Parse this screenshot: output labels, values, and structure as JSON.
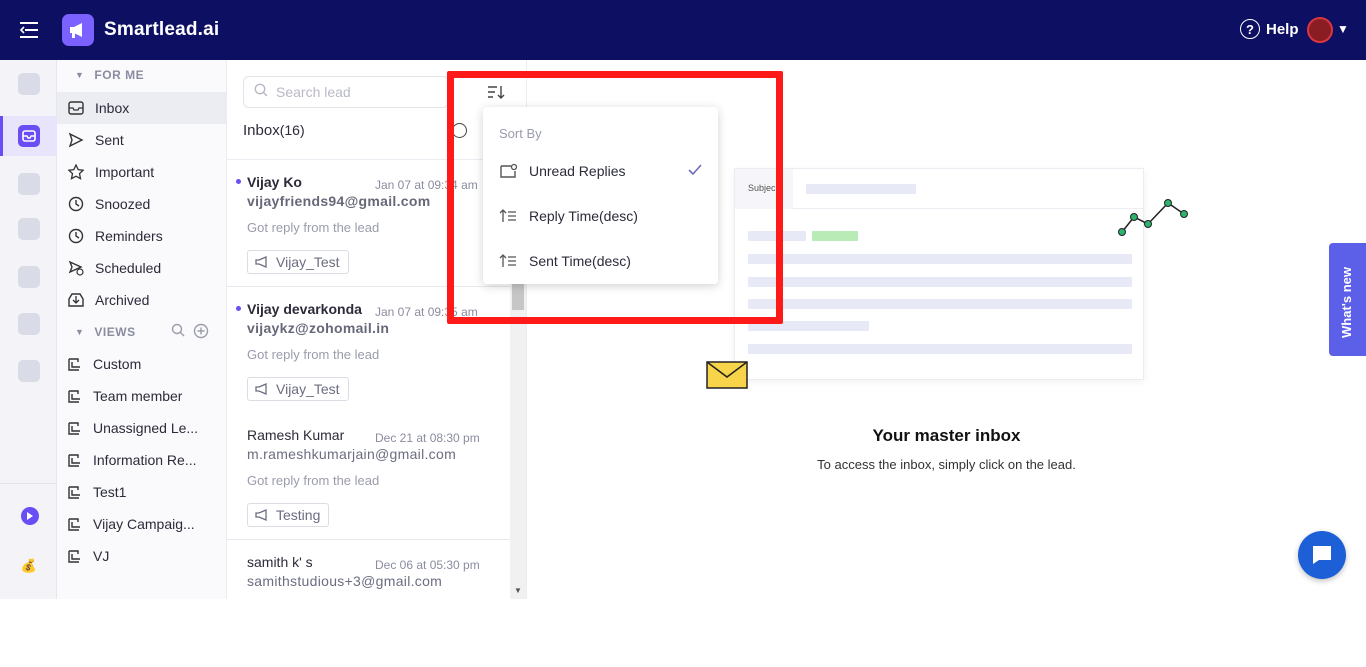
{
  "brand": {
    "name": "Smartlead.ai"
  },
  "topbar": {
    "help_label": "Help"
  },
  "nav": {
    "for_me_label": "FOR ME",
    "views_label": "VIEWS",
    "items": [
      {
        "label": "Inbox",
        "icon": "inbox-icon"
      },
      {
        "label": "Sent",
        "icon": "send-icon"
      },
      {
        "label": "Important",
        "icon": "star-icon"
      },
      {
        "label": "Snoozed",
        "icon": "clock-icon"
      },
      {
        "label": "Reminders",
        "icon": "clock-icon"
      },
      {
        "label": "Scheduled",
        "icon": "send-clock-icon"
      },
      {
        "label": "Archived",
        "icon": "archive-icon"
      }
    ],
    "views": [
      {
        "label": "Custom"
      },
      {
        "label": "Team member"
      },
      {
        "label": "Unassigned Le..."
      },
      {
        "label": "Information Re..."
      },
      {
        "label": "Test1"
      },
      {
        "label": "Vijay Campaig..."
      },
      {
        "label": "VJ"
      }
    ]
  },
  "list": {
    "search_placeholder": "Search lead",
    "title": "Inbox",
    "count": "(16)",
    "leads": [
      {
        "name": "Vijay Ko",
        "date": "Jan 07 at 09:34 am",
        "email": "vijayfriends94@gmail.com",
        "preview": "Got reply from the lead",
        "tag": "Vijay_Test",
        "unread": true
      },
      {
        "name": "Vijay devarkonda",
        "date": "Jan 07 at 09:35 am",
        "email": "vijaykz@zohomail.in",
        "preview": "Got reply from the lead",
        "tag": "Vijay_Test",
        "unread": true
      },
      {
        "name": "Ramesh Kumar",
        "date": "Dec 21 at 08:30 pm",
        "email": "m.rameshkumarjain@gmail.com",
        "preview": "Got reply from the lead",
        "tag": "Testing",
        "unread": false
      },
      {
        "name": "samith k' s",
        "date": "Dec 06 at 05:30 pm",
        "email": "samithstudious+3@gmail.com",
        "preview": "",
        "tag": "",
        "unread": false
      }
    ]
  },
  "sort_menu": {
    "header": "Sort By",
    "options": [
      {
        "label": "Unread Replies",
        "selected": true
      },
      {
        "label": "Reply Time(desc)",
        "selected": false
      },
      {
        "label": "Sent Time(desc)",
        "selected": false
      }
    ]
  },
  "main": {
    "card_subject_label": "Subjec",
    "title": "Your master inbox",
    "subtitle": "To access the inbox, simply click on the lead."
  },
  "whats_new_label": "What's new",
  "colors": {
    "topbar": "#0d0f63",
    "accent": "#6a4df5",
    "highlight": "#ff1a1a",
    "whats_new": "#5c5fe8"
  }
}
